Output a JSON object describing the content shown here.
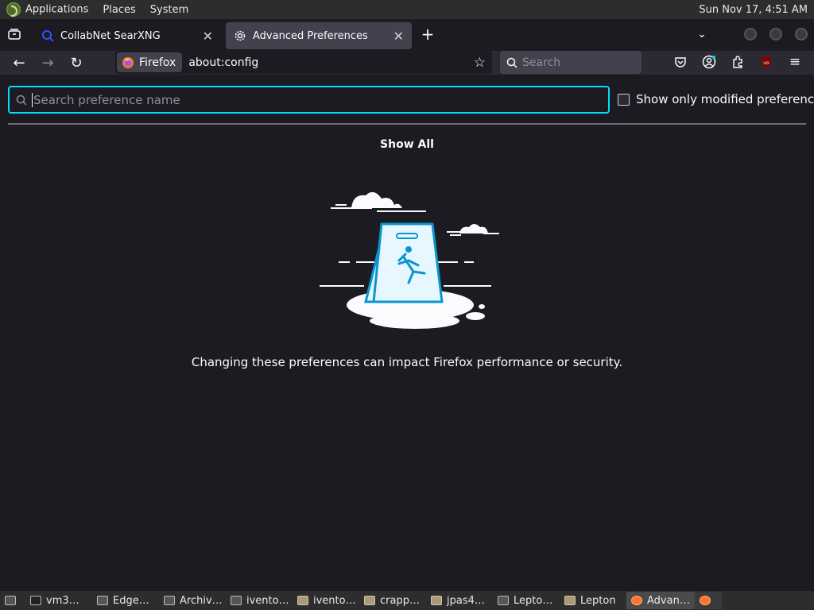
{
  "top_panel": {
    "menus": [
      "Applications",
      "Places",
      "System"
    ],
    "clock": "Sun Nov 17,  4:51 AM"
  },
  "tabs": [
    {
      "title": "CollabNet SearXNG",
      "icon": "searxng-icon"
    },
    {
      "title": "Advanced Preferences",
      "icon": "gear-icon",
      "active": true
    }
  ],
  "navbar": {
    "identity_label": "Firefox",
    "url": "about:config",
    "search_placeholder": "Search"
  },
  "config_page": {
    "search_placeholder": "Search preference name",
    "checkbox_label": "Show only modified preferences",
    "show_all": "Show All",
    "warning": "Changing these preferences can impact Firefox performance or security."
  },
  "taskbar": {
    "items": [
      {
        "label": "vm3…",
        "icon": "terminal-icon"
      },
      {
        "label": "Edge…",
        "icon": "app-icon"
      },
      {
        "label": "Archiv…",
        "icon": "app-icon"
      },
      {
        "label": "ivento…",
        "icon": "app-icon"
      },
      {
        "label": "ivento…",
        "icon": "folder-icon"
      },
      {
        "label": "crapp…",
        "icon": "folder-icon"
      },
      {
        "label": "jpas4…",
        "icon": "folder-icon"
      },
      {
        "label": "Lepto…",
        "icon": "app-icon"
      },
      {
        "label": "Lepton",
        "icon": "folder-icon"
      },
      {
        "label": "Advan…",
        "icon": "firefox-icon"
      }
    ]
  },
  "colors": {
    "accent": "#00ddff",
    "background": "#1c1b22",
    "toolbar": "#2b2a33",
    "panel": "#2d2d2d"
  }
}
